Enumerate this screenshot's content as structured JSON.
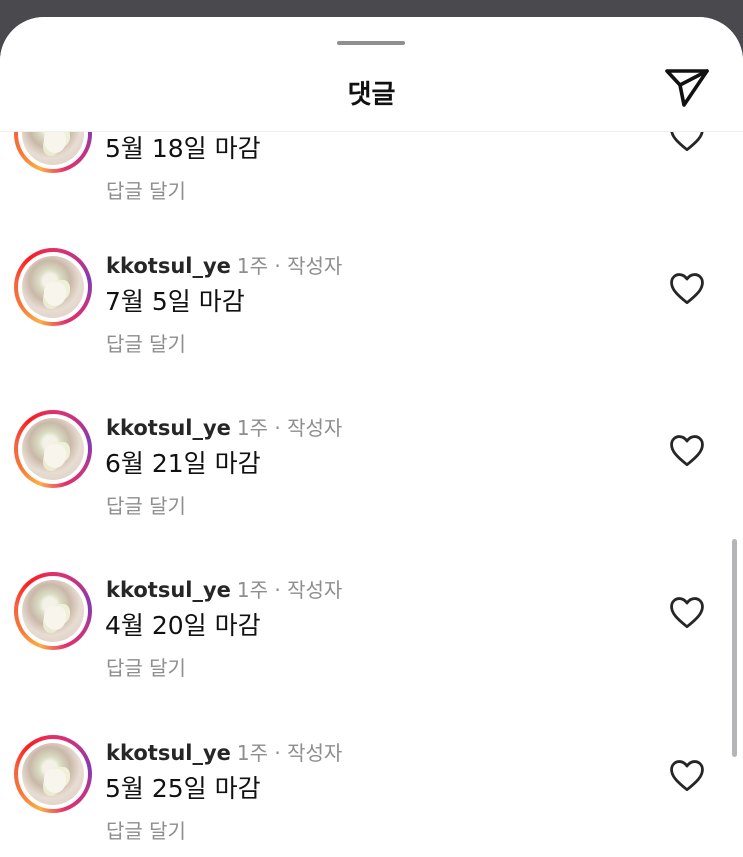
{
  "header": {
    "title": "댓글",
    "send_icon": "paper-plane-icon"
  },
  "partial_comment": {
    "text": "5월 18일 마감",
    "reply_label": "답글 달기"
  },
  "comments": [
    {
      "username": "kkotsul_ye",
      "meta": "1주 · 작성자",
      "text": "7월 5일 마감",
      "reply_label": "답글 달기"
    },
    {
      "username": "kkotsul_ye",
      "meta": "1주 · 작성자",
      "text": "6월 21일 마감",
      "reply_label": "답글 달기"
    },
    {
      "username": "kkotsul_ye",
      "meta": "1주 · 작성자",
      "text": "4월 20일 마감",
      "reply_label": "답글 달기"
    },
    {
      "username": "kkotsul_ye",
      "meta": "1주 · 작성자",
      "text": "5월 25일 마감",
      "reply_label": "답글 달기"
    }
  ],
  "colors": {
    "story_ring": [
      "#fcaf45",
      "#e1306c",
      "#833ab4"
    ],
    "secondary_text": "#8e8e8e"
  }
}
